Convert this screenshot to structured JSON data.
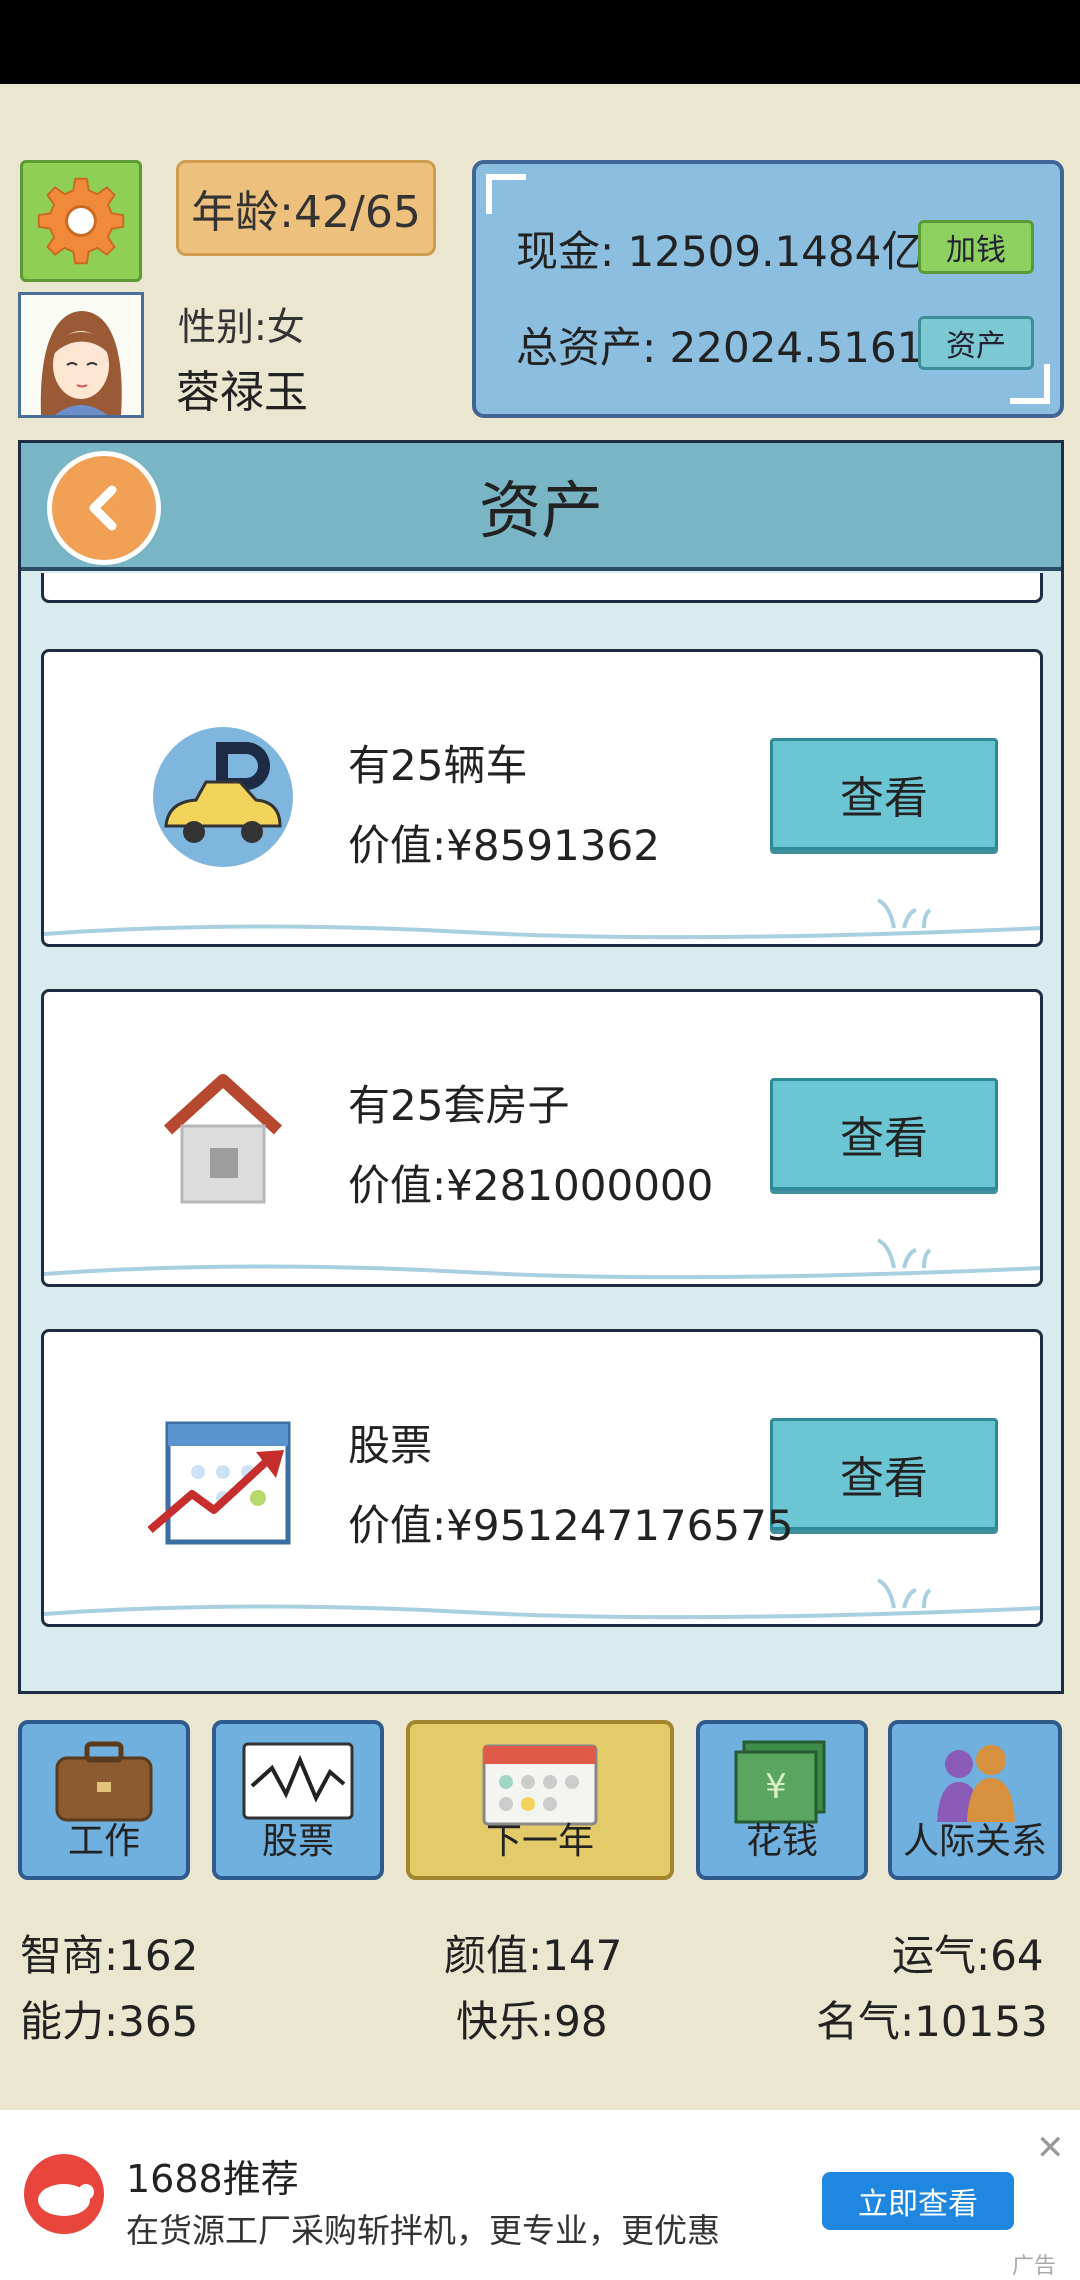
{
  "player": {
    "age": "年龄:42/65",
    "gender": "性别:女",
    "name": "蓉禄玉"
  },
  "money": {
    "cash": "现金: 12509.1484亿",
    "total_assets": "总资产: 22024.5161",
    "add_money_label": "加钱",
    "assets_label": "资产"
  },
  "dialog": {
    "title": "资产",
    "items": [
      {
        "icon": "car-icon",
        "name": "有25辆车",
        "value": "价值:¥8591362",
        "button": "查看"
      },
      {
        "icon": "house-icon",
        "name": "有25套房子",
        "value": "价值:¥281000000",
        "button": "查看"
      },
      {
        "icon": "stock-chart-icon",
        "name": "股票",
        "value": "价值:¥951247176575",
        "button": "查看"
      }
    ]
  },
  "nav": [
    {
      "label": "工作",
      "icon": "briefcase-icon"
    },
    {
      "label": "股票",
      "icon": "stock-icon"
    },
    {
      "label": "下一年",
      "icon": "calendar-icon"
    },
    {
      "label": "花钱",
      "icon": "money-icon"
    },
    {
      "label": "人际关系",
      "icon": "people-icon"
    }
  ],
  "stats": {
    "iq": "智商:162",
    "looks": "颜值:147",
    "luck": "运气:64",
    "ability": "能力:365",
    "happiness": "快乐:98",
    "fame": "名气:10153"
  },
  "ad": {
    "title": "1688推荐",
    "desc": "在货源工厂采购斩拌机，更专业，更优惠",
    "button": "立即查看",
    "tag": "广告",
    "close": "✕"
  },
  "colors": {
    "background": "#eae6cf",
    "panel_blue": "#8cbedf",
    "button_teal": "#6cc5d2",
    "accent_orange": "#f0a155"
  }
}
